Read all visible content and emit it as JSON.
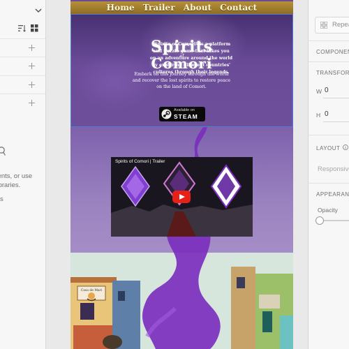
{
  "left_panel": {
    "empty_state_lines": [
      "onents, or use",
      "y libraries.",
      "s"
    ]
  },
  "artboard": {
    "nav": [
      "Home",
      "Trailer",
      "About",
      "Contact"
    ],
    "logo": {
      "top": "Spirits",
      "mid": "of",
      "bottom": "Comori"
    },
    "tagline": "Embark on this journey through the world and recover the lost spirits to restore peace on the land of Comori.",
    "steam": {
      "available": "Available on",
      "word": "STEAM"
    },
    "video_title": "Spirits of Comori | Trailer",
    "town_text": "\"Spirits of Comori\" is a platform and puzzle game that takes you on an adventure around the world by exploring different countries' cultures through their legends.",
    "shop_sign": "Casa de Mari"
  },
  "right_panel": {
    "repeat_grid": "Repeat Grid",
    "component_heading": "COMPONENT",
    "transform_heading": "TRANSFORM",
    "w_label": "W",
    "w_value": "0",
    "h_label": "H",
    "h_value": "0",
    "layout_heading": "LAYOUT",
    "responsive_label": "Responsive",
    "appearance_heading": "APPEARANCE",
    "opacity_label": "Opacity",
    "opacity_value": 0
  },
  "colors": {
    "nav_bar": "#a88331",
    "hero_purple": "#5b3f88",
    "tendril": "#7b2fbd",
    "selection": "#4b7fd6",
    "play_red": "#e62117"
  },
  "icons": [
    "chevron-down-icon",
    "sort-icon",
    "grid-view-icon",
    "add-icon",
    "search-icon",
    "steam-logo-icon",
    "play-icon",
    "repeat-grid-icon",
    "info-icon"
  ]
}
